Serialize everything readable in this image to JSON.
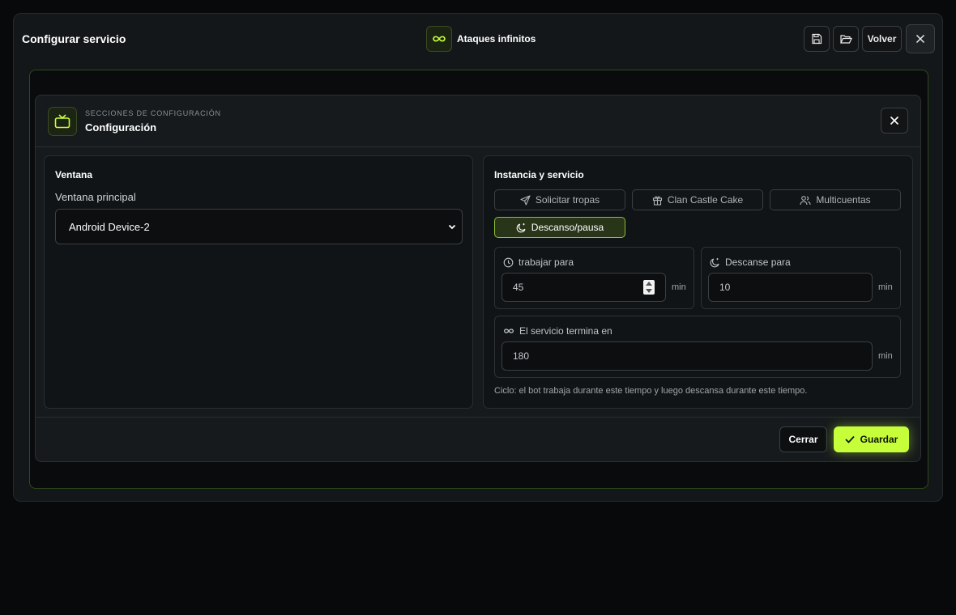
{
  "window": {
    "title": "Configurar servicio",
    "service_name": "Ataques infinitos",
    "back_label": "Volver"
  },
  "modal": {
    "subtitle": "SECCIONES DE CONFIGURACIÓN",
    "title": "Configuración"
  },
  "left_panel": {
    "title": "Ventana",
    "field_label": "Ventana principal",
    "selected_value": "Android Device-2"
  },
  "right_panel": {
    "title": "Instancia y servicio",
    "tabs": [
      {
        "label": "Solicitar tropas",
        "icon": "send-icon"
      },
      {
        "label": "Clan Castle Cake",
        "icon": "gift-icon"
      },
      {
        "label": "Multicuentas",
        "icon": "users-icon"
      },
      {
        "label": "Descanso/pausa",
        "icon": "moon-icon",
        "active": true
      }
    ],
    "work": {
      "label": "trabajar para",
      "value": "45",
      "unit": "min"
    },
    "rest": {
      "label": "Descanse para",
      "value": "10",
      "unit": "min"
    },
    "end": {
      "label": "El servicio termina en",
      "value": "180",
      "unit": "min"
    },
    "note": "Ciclo: el bot trabaja durante este tiempo y luego descansa durante este tiempo."
  },
  "footer": {
    "cancel_label": "Cerrar",
    "save_label": "Guardar"
  },
  "colors": {
    "accent": "#c6ff3a",
    "background": "#08090a"
  }
}
